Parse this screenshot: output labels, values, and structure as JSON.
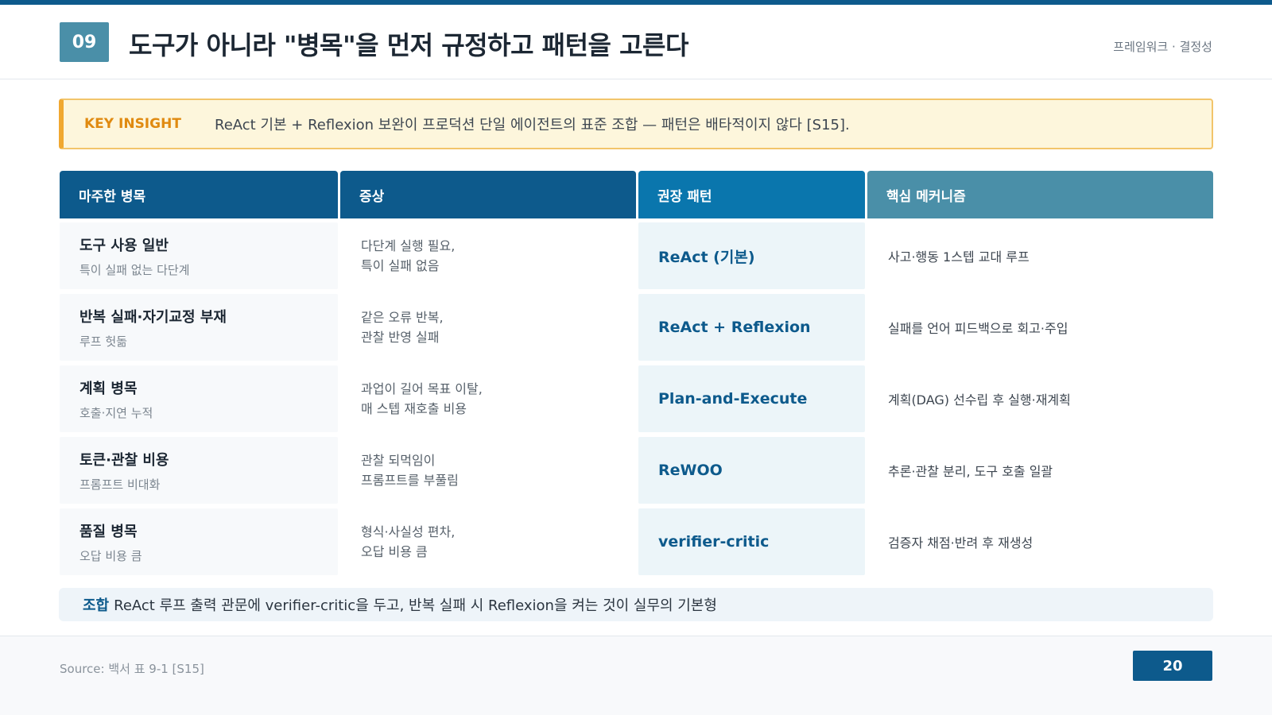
{
  "header": {
    "section_number": "09",
    "title": "도구가 아니라 \"병목\"을 먼저 규정하고 패턴을 고른다",
    "tag": "프레임워크 · 결정성"
  },
  "insight": {
    "label": "KEY INSIGHT",
    "text": "ReAct 기본 + Reflexion 보완이 프로덕션 단일 에이전트의 표준 조합 — 패턴은 배타적이지 않다 [S15]."
  },
  "table": {
    "columns": [
      "마주한 병목",
      "증상",
      "권장 패턴",
      "핵심 메커니즘"
    ],
    "rows": [
      {
        "bottleneck": "도구 사용 일반",
        "bottleneck_sub": "특이 실패 없는 다단계",
        "symptom_line1": "다단계 실행 필요,",
        "symptom_line2": "특이 실패 없음",
        "pattern": "ReAct (기본)",
        "mechanism": "사고·행동 1스텝 교대 루프"
      },
      {
        "bottleneck": "반복 실패·자기교정 부재",
        "bottleneck_sub": "루프 헛돎",
        "symptom_line1": "같은 오류 반복,",
        "symptom_line2": "관찰 반영 실패",
        "pattern": "ReAct + Reflexion",
        "mechanism": "실패를 언어 피드백으로 회고·주입"
      },
      {
        "bottleneck": "계획 병목",
        "bottleneck_sub": "호출·지연 누적",
        "symptom_line1": "과업이 길어 목표 이탈,",
        "symptom_line2": "매 스텝 재호출 비용",
        "pattern": "Plan-and-Execute",
        "mechanism": "계획(DAG) 선수립 후 실행·재계획"
      },
      {
        "bottleneck": "토큰·관찰 비용",
        "bottleneck_sub": "프롬프트 비대화",
        "symptom_line1": "관찰 되먹임이",
        "symptom_line2": "프롬프트를 부풀림",
        "pattern": "ReWOO",
        "mechanism": "추론·관찰 분리, 도구 호출 일괄"
      },
      {
        "bottleneck": "품질 병목",
        "bottleneck_sub": "오답 비용 큼",
        "symptom_line1": "형식·사실성 편차,",
        "symptom_line2": "오답 비용 큼",
        "pattern": "verifier-critic",
        "mechanism": "검증자 채점·반려 후 재생성"
      }
    ]
  },
  "combo": {
    "label": "조합",
    "text": "ReAct 루프 출력 관문에 verifier-critic을 두고, 반복 실패 시 Reflexion을 켜는 것이 실무의 기본형"
  },
  "footer": {
    "source": "Source: 백서 표 9-1 [S15]",
    "page_number": "20"
  },
  "colors": {
    "primary": "#0d5a8c",
    "accent_blue": "#0a76ad",
    "teal": "#4a8fa8",
    "insight_accent": "#f0a830"
  }
}
